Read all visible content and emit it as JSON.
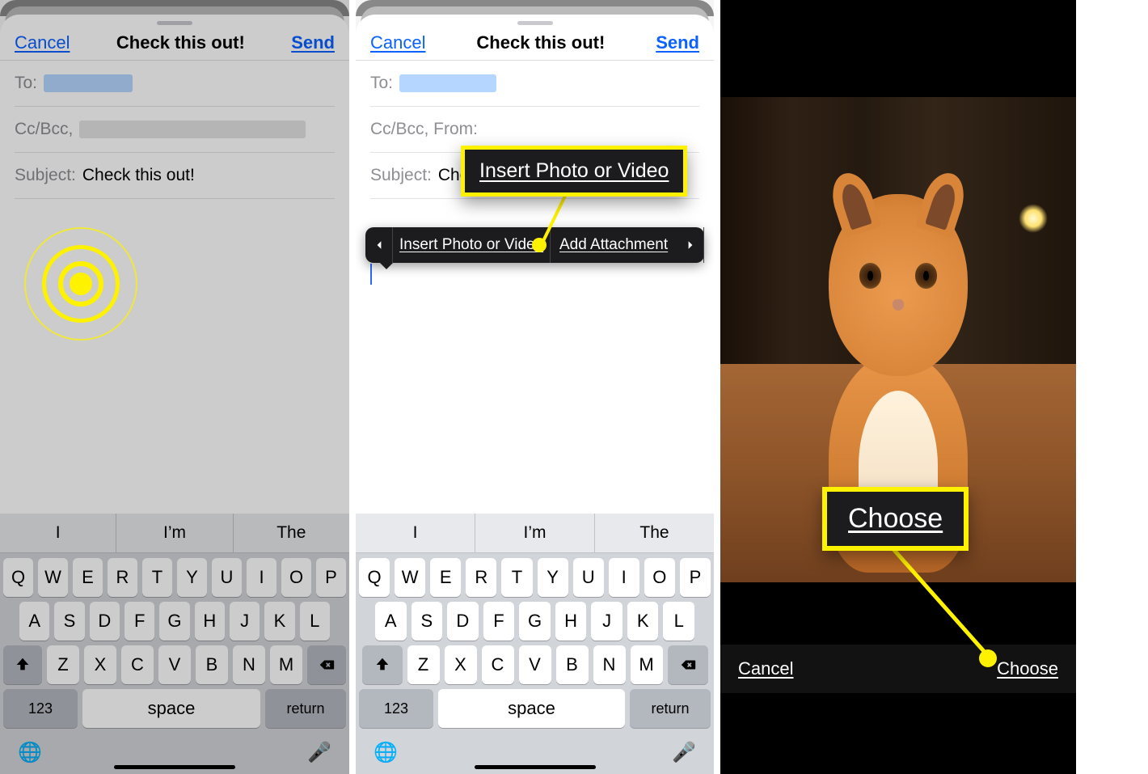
{
  "panel1": {
    "nav": {
      "cancel": "Cancel",
      "title": "Check this out!",
      "send": "Send"
    },
    "fields": {
      "to": "To:",
      "ccbcc": "Cc/Bcc,",
      "subject_label": "Subject:",
      "subject_value": "Check this out!"
    }
  },
  "panel2": {
    "nav": {
      "cancel": "Cancel",
      "title": "Check this out!",
      "send": "Send"
    },
    "fields": {
      "to": "To:",
      "ccbcc": "Cc/Bcc, From:",
      "subject_label": "Subject:",
      "subject_value": "Che"
    },
    "context_menu": {
      "item1": "Insert Photo or Video",
      "item2": "Add Attachment"
    },
    "callout": "Insert Photo or Video"
  },
  "keyboard": {
    "suggestions": [
      "I",
      "I’m",
      "The"
    ],
    "row1": [
      "Q",
      "W",
      "E",
      "R",
      "T",
      "Y",
      "U",
      "I",
      "O",
      "P"
    ],
    "row2": [
      "A",
      "S",
      "D",
      "F",
      "G",
      "H",
      "J",
      "K",
      "L"
    ],
    "row3": [
      "Z",
      "X",
      "C",
      "V",
      "B",
      "N",
      "M"
    ],
    "k123": "123",
    "space": "space",
    "return": "return"
  },
  "panel3": {
    "callout": "Choose",
    "bar": {
      "cancel": "Cancel",
      "choose": "Choose"
    }
  }
}
